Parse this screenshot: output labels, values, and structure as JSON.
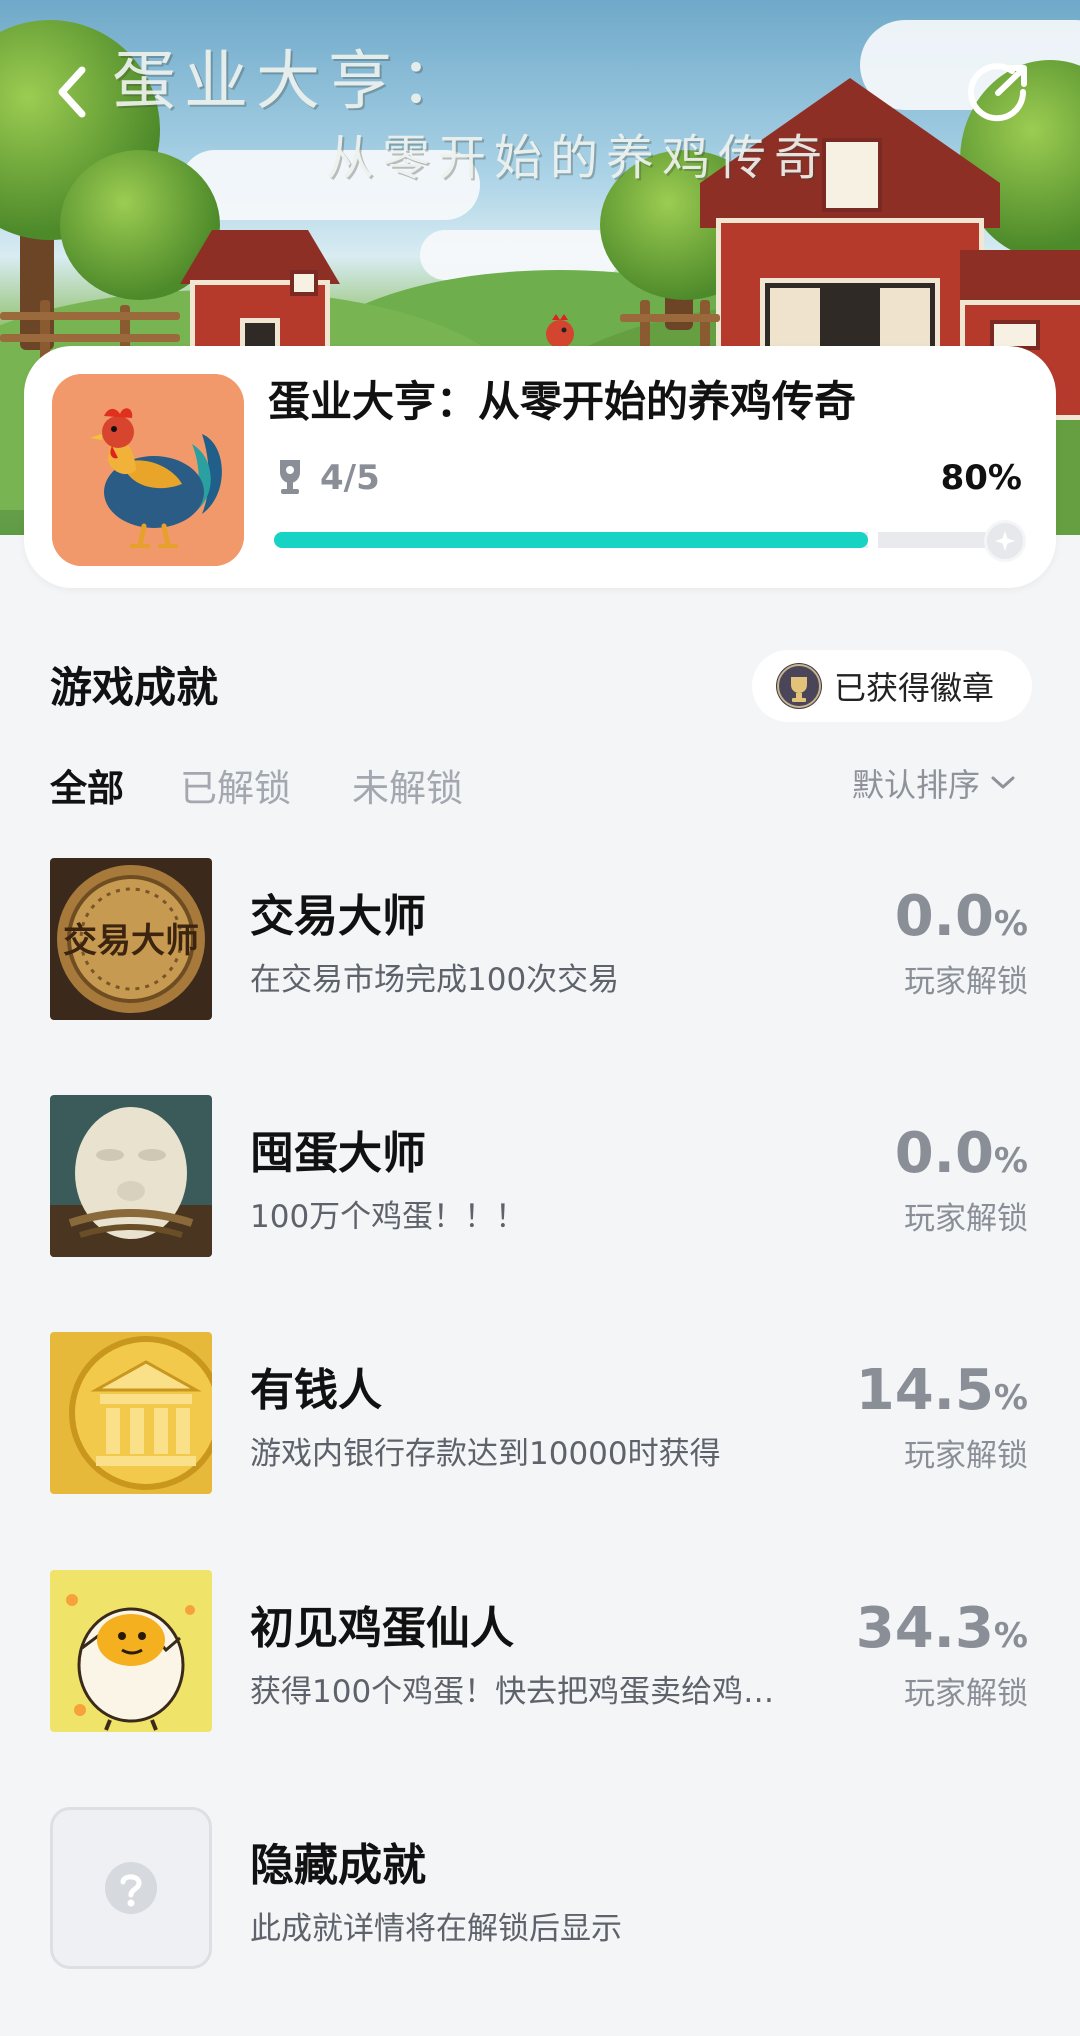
{
  "hero": {
    "title_line1": "蛋业大亨：",
    "title_line2": "从零开始的养鸡传奇"
  },
  "game": {
    "title": "蛋业大亨：从零开始的养鸡传奇",
    "progress_count": "4/5",
    "progress_percent": "80%",
    "progress_value": 0.8
  },
  "section": {
    "title": "游戏成就",
    "badge_button": "已获得徽章"
  },
  "tabs": [
    {
      "label": "全部",
      "active": true
    },
    {
      "label": "已解锁",
      "active": false
    },
    {
      "label": "未解锁",
      "active": false
    }
  ],
  "sort": {
    "label": "默认排序"
  },
  "achievements": [
    {
      "name": "交易大师",
      "desc": "在交易市场完成100次交易",
      "rate": "0.0",
      "rate_label": "玩家解锁",
      "thumb_text": "交易大师",
      "icon": "coin-medal-icon"
    },
    {
      "name": "囤蛋大师",
      "desc": "100万个鸡蛋！！！",
      "rate": "0.0",
      "rate_label": "玩家解锁",
      "icon": "egg-character-icon"
    },
    {
      "name": "有钱人",
      "desc": "游戏内银行存款达到10000时获得",
      "rate": "14.5",
      "rate_label": "玩家解锁",
      "icon": "bank-coin-icon"
    },
    {
      "name": "初见鸡蛋仙人",
      "desc": "获得100个鸡蛋！快去把鸡蛋卖给鸡…",
      "rate": "34.3",
      "rate_label": "玩家解锁",
      "icon": "cracked-egg-icon"
    }
  ],
  "hidden_achievement": {
    "name": "隐藏成就",
    "desc": "此成就详情将在解锁后显示",
    "icon": "question-icon"
  }
}
